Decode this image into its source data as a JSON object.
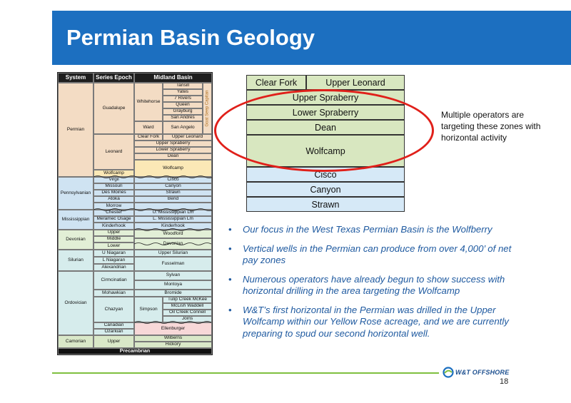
{
  "header": {
    "title": "Permian Basin Geology"
  },
  "strat_table": {
    "headers": [
      "System",
      "Series Epoch",
      "Midland Basin"
    ],
    "systems": [
      "Permian",
      "Pennsylvanian",
      "Mississippian",
      "Devonian",
      "Silurian",
      "Ordovician",
      "Camorian"
    ],
    "epochs": [
      "Guadalupe",
      "Leonard",
      "Wolfcamp",
      "Virgil",
      "Missouri",
      "Des Moines",
      "Atoka",
      "Morrow",
      "Chester",
      "Meramec Osage",
      "Kinderhook",
      "Upper",
      "Middle",
      "Lower",
      "U Niagaran",
      "L Niagaran",
      "Alexandrian",
      "Cirmcinatian",
      "Mohawkian",
      "Chazyan",
      "Canadian",
      "Ozarkian",
      "Upper"
    ],
    "groups": [
      "Whitehorse",
      "Ward",
      "Simpson"
    ],
    "formations": [
      "Tansill",
      "Yates",
      "7 Rivers",
      "Queen",
      "Grayburg",
      "San Andres",
      "San Angelo",
      "Clear Fork",
      "Upper Leonard",
      "Upper Spraberry",
      "Lower Spraberry",
      "Dean",
      "Wolfcamp",
      "Cisco",
      "Canyon",
      "Strawn",
      "Bend",
      "U. Mississippian Lm",
      "L. Mississippian Lm",
      "Kinderhook",
      "Woodford",
      "Devonian",
      "Upper Silurian",
      "Fusselman",
      "Sylvan",
      "Montoya",
      "Bromide",
      "Tulip Creek  McKee",
      "McLish  Waddell",
      "Oil Creek  Connell",
      "Joins",
      "Ellenburger",
      "Wilberns",
      "Hickory"
    ],
    "side_label": "Goat Seep Capitan",
    "bottom": "Precambrian"
  },
  "zone_chart": {
    "zones": [
      "Clear Fork",
      "Upper Leonard",
      "Upper Spraberry",
      "Lower Spraberry",
      "Dean",
      "Wolfcamp",
      "Cisco",
      "Canyon",
      "Strawn"
    ],
    "colors": {
      "green": "#d8e7c0",
      "blue": "#d6e9f7",
      "border": "#333333"
    }
  },
  "callout": "Multiple operators are targeting these zones with horizontal activity",
  "bullets": [
    "Our focus in the West Texas Permian Basin is the Wolfberry",
    "Vertical wells in the Permian can produce from over 4,000’ of net pay zones",
    "Numerous operators have already begun to show success with horizontal drilling in the area targeting the Wolfcamp",
    "W&T’s first horizontal in the Permian was drilled in the Upper Wolfcamp within our Yellow Rose acreage, and we are currently preparing to spud our second horizontal well."
  ],
  "footer": {
    "logo": "W&T OFFSHORE",
    "page": "18"
  },
  "colors": {
    "header_blue": "#1c6fc0",
    "bullet_blue": "#1f5aa0",
    "oval_red": "#e0201a",
    "footer_green": "#7fbf3f"
  }
}
